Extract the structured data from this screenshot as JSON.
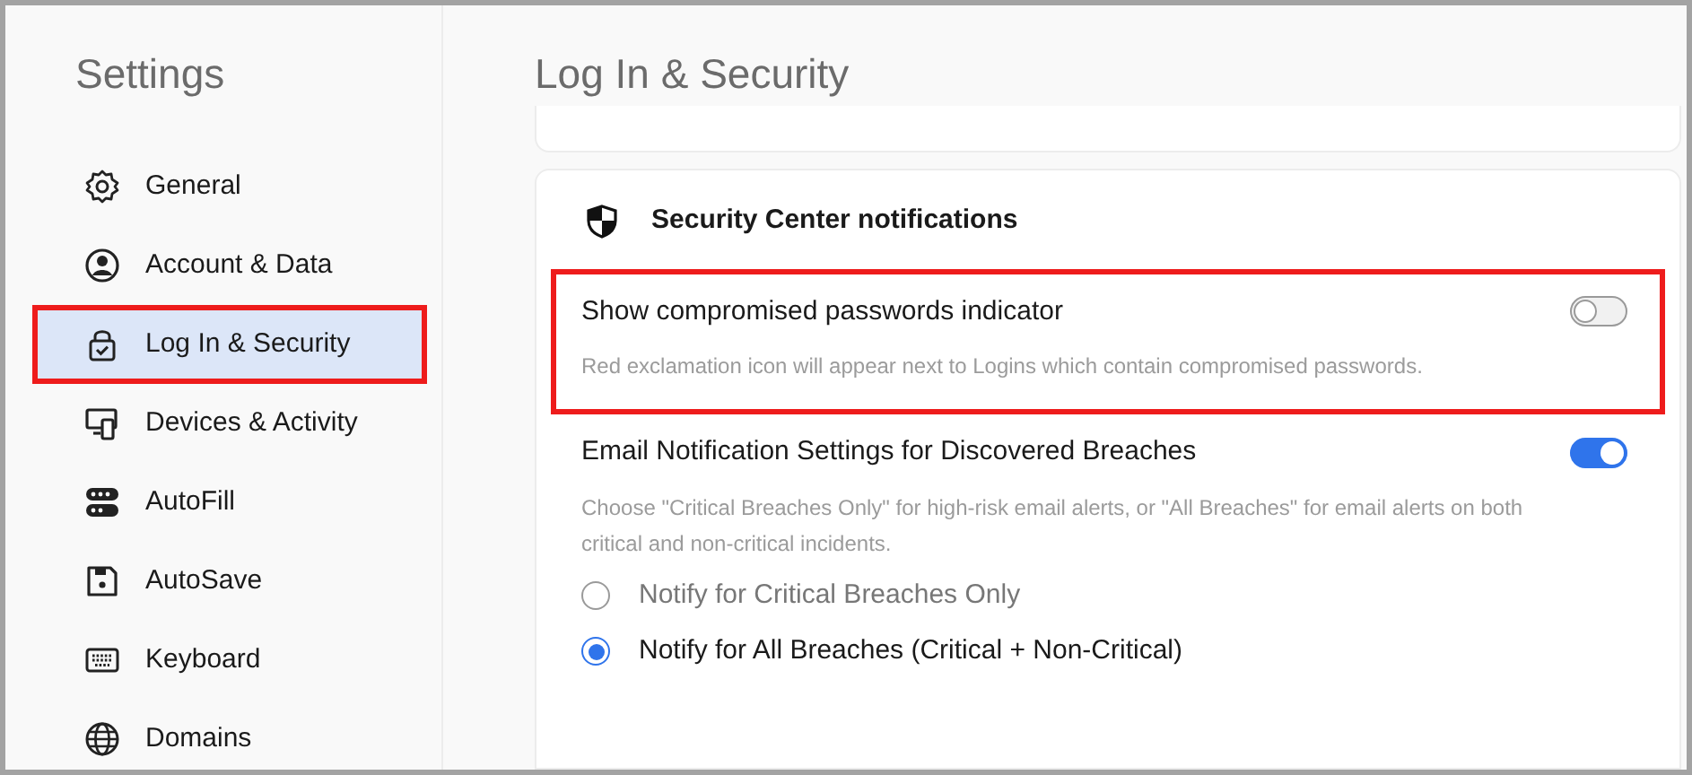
{
  "sidebar": {
    "title": "Settings",
    "items": [
      {
        "label": "General",
        "kind": "gear",
        "selected": false,
        "highlighted": false
      },
      {
        "label": "Account & Data",
        "kind": "person",
        "selected": false,
        "highlighted": false
      },
      {
        "label": "Log In & Security",
        "kind": "lock",
        "selected": true,
        "highlighted": true
      },
      {
        "label": "Devices & Activity",
        "kind": "devices",
        "selected": false,
        "highlighted": false
      },
      {
        "label": "AutoFill",
        "kind": "autofill",
        "selected": false,
        "highlighted": false
      },
      {
        "label": "AutoSave",
        "kind": "save",
        "selected": false,
        "highlighted": false
      },
      {
        "label": "Keyboard",
        "kind": "keyboard",
        "selected": false,
        "highlighted": false
      },
      {
        "label": "Domains",
        "kind": "globe",
        "selected": false,
        "highlighted": false
      }
    ]
  },
  "page_title": "Log In & Security",
  "section": {
    "heading": "Security Center notifications",
    "settings": [
      {
        "label": "Show compromised passwords indicator",
        "description": "Red exclamation icon will appear next to Logins which contain compromised passwords.",
        "on": false,
        "highlighted": true
      },
      {
        "label": "Email Notification Settings for Discovered Breaches",
        "description": "Choose \"Critical Breaches Only\" for high-risk email alerts, or \"All Breaches\" for email alerts on both critical and non-critical incidents.",
        "on": true,
        "highlighted": false,
        "options": [
          {
            "label": "Notify for Critical Breaches Only",
            "selected": false
          },
          {
            "label": "Notify for All Breaches (Critical + Non-Critical)",
            "selected": true
          }
        ]
      }
    ]
  }
}
